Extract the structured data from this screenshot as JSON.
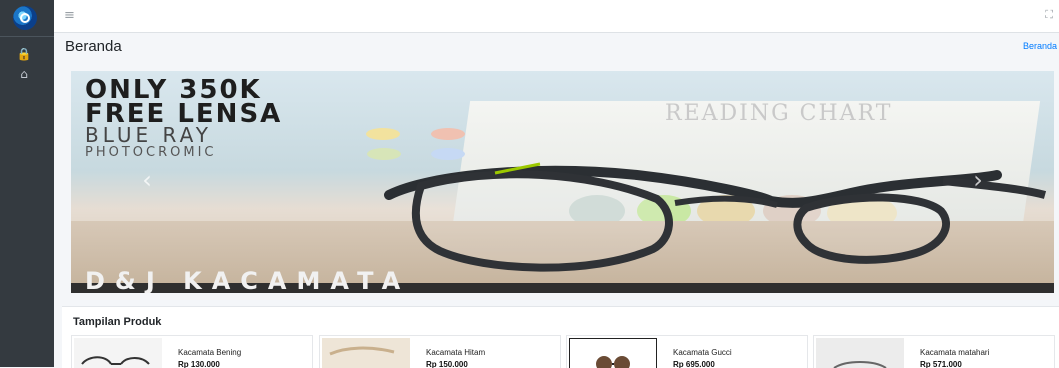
{
  "header": {
    "page_title": "Beranda",
    "breadcrumb": "Beranda"
  },
  "sidebar": {
    "icons": [
      "lock-icon",
      "home-icon"
    ]
  },
  "hero": {
    "line1": "ONLY 350K",
    "line2": "FREE LENSA",
    "line3": "BLUE RAY",
    "line4": "PHOTOCROMIC",
    "reading_chart": "READING CHART",
    "brand": "D&J KACAMATA"
  },
  "products": {
    "title": "Tampilan Produk",
    "items": [
      {
        "name": "Kacamata Bening",
        "price": "Rp 130.000"
      },
      {
        "name": "Kacamata Hitam",
        "price": "Rp 150.000"
      },
      {
        "name": "Kacamata Gucci",
        "price": "Rp 695.000"
      },
      {
        "name": "Kacamata matahari",
        "price": "Rp 571.000"
      }
    ]
  }
}
